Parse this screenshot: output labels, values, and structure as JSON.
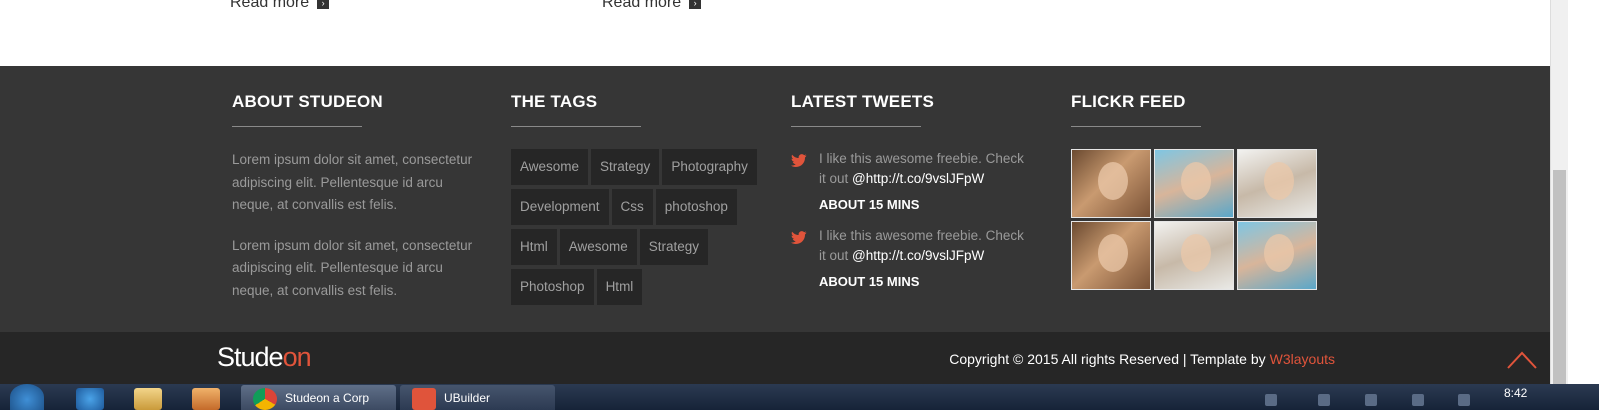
{
  "top": {
    "read_more_left": "Read more",
    "read_more_right": "Read more",
    "arrow_glyph": "›"
  },
  "footer": {
    "about": {
      "title": "ABOUT STUDEON",
      "paragraphs": [
        "Lorem ipsum dolor sit amet, consectetur adipiscing elit. Pellentesque id arcu neque, at convallis est felis.",
        "Lorem ipsum dolor sit amet, consectetur adipiscing elit. Pellentesque id arcu neque, at convallis est felis."
      ]
    },
    "tags": {
      "title": "THE TAGS",
      "items": [
        "Awesome",
        "Strategy",
        "Photography",
        "Development",
        "Css",
        "photoshop",
        "Html",
        "Awesome",
        "Strategy",
        "Photoshop",
        "Html"
      ]
    },
    "tweets": {
      "title": "LATEST TWEETS",
      "items": [
        {
          "text": "I like this awesome freebie. Check it out ",
          "link": "@http://t.co/9vslJFpW",
          "time": "ABOUT 15 MINS"
        },
        {
          "text": "I like this awesome freebie. Check it out ",
          "link": "@http://t.co/9vslJFpW",
          "time": "ABOUT 15 MINS"
        }
      ]
    },
    "flickr": {
      "title": "FLICKR FEED",
      "photos": [
        "warm",
        "blue",
        "light",
        "warm",
        "light",
        "blue"
      ]
    }
  },
  "bottom": {
    "logo_main": "Stude",
    "logo_accent": "on",
    "copyright": "Copyright © 2015 All rights Reserved | Template by",
    "brand": "W3layouts"
  },
  "taskbar": {
    "task1": "Studeon a Corp",
    "task2": "UBuilder",
    "clock": "8:42"
  },
  "colors": {
    "accent": "#e0543b",
    "footer_bg": "#363636",
    "bottom_bg": "#262626"
  }
}
